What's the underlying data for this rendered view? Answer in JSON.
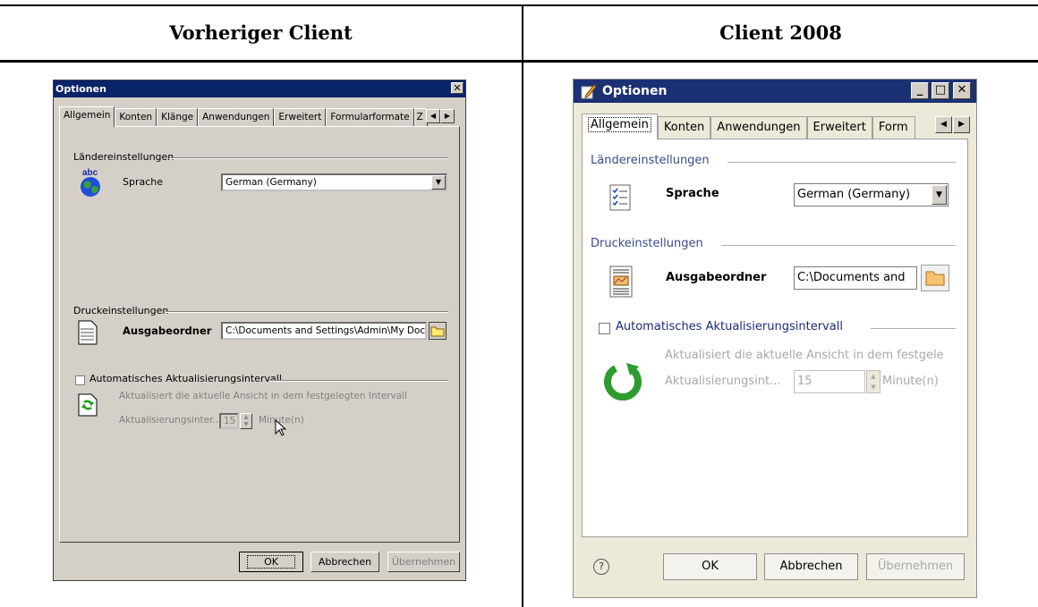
{
  "table": {
    "left_header": "Vorheriger Client",
    "right_header": "Client 2008"
  },
  "old_dialog": {
    "title": "Optionen",
    "close_glyph": "✕",
    "tabs": [
      "Allgemein",
      "Konten",
      "Klänge",
      "Anwendungen",
      "Erweitert",
      "Formularformate",
      "Z"
    ],
    "regional_section": "Ländereinstellungen",
    "regional_icon_label": "abc",
    "language_label": "Sprache",
    "language_value": "German (Germany)",
    "print_section": "Druckeinstellungen",
    "output_label": "Ausgabeordner",
    "output_value": "C:\\Documents and Settings\\Admin\\My Doc",
    "auto_refresh_label": "Automatisches Aktualisierungsintervall",
    "auto_refresh_checked": false,
    "refresh_description": "Aktualisiert die aktuelle Ansicht in dem festgelegten Intervall",
    "interval_label": "Aktualisierungsinter...",
    "interval_value": "15",
    "interval_unit": "Minute(n)",
    "ok_label": "OK",
    "cancel_label": "Abbrechen",
    "apply_label": "Übernehmen"
  },
  "new_dialog": {
    "title": "Optionen",
    "tabs": [
      "Allgemein",
      "Konten",
      "Anwendungen",
      "Erweitert",
      "Form"
    ],
    "regional_section": "Ländereinstellungen",
    "language_label": "Sprache",
    "language_value": "German (Germany)",
    "print_section": "Druckeinstellungen",
    "output_label": "Ausgabeordner",
    "output_value": "C:\\Documents and",
    "auto_refresh_label": "Automatisches Aktualisierungsintervall",
    "auto_refresh_checked": false,
    "refresh_description": "Aktualisiert die aktuelle Ansicht in dem festgele",
    "interval_label": "Aktualisierungsint...",
    "interval_value": "15",
    "interval_unit": "Minute(n)",
    "help_glyph": "?",
    "ok_label": "OK",
    "cancel_label": "Abbrechen",
    "apply_label": "Übernehmen"
  }
}
